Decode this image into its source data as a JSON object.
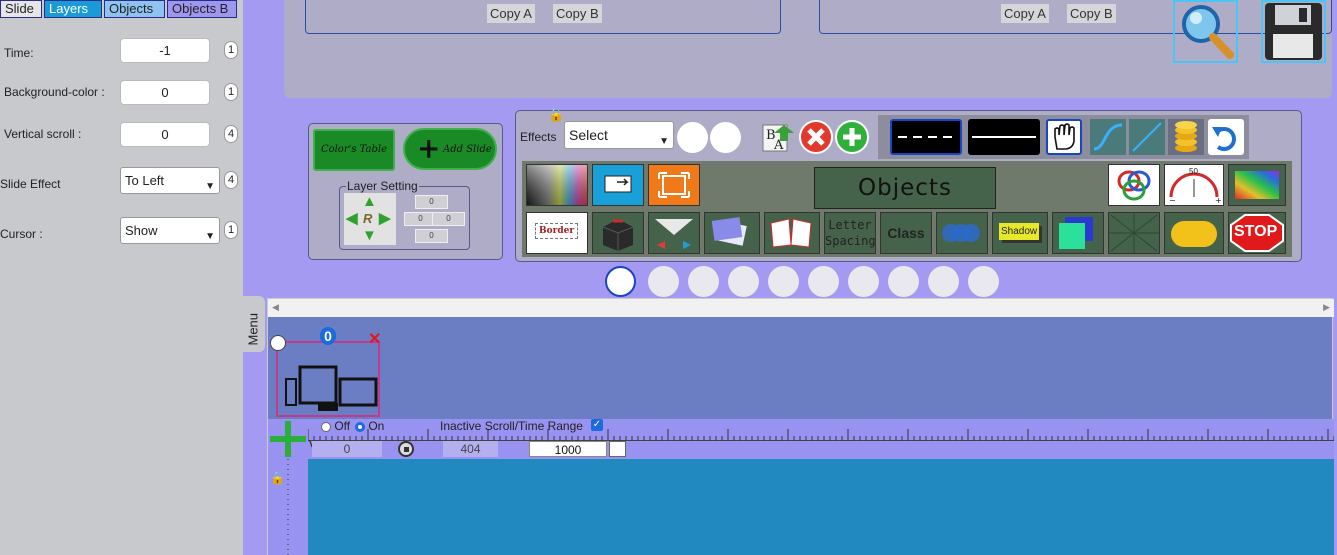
{
  "tabs": [
    "Slide",
    "Layers",
    "Objects",
    "Objects B"
  ],
  "props": {
    "time_label": "Time:",
    "time_value": "-1",
    "time_badge": "1",
    "bg_label": "Background-color :",
    "bg_value": "0",
    "bg_badge": "1",
    "vscroll_label": "Vertical scroll :",
    "vscroll_value": "0",
    "vscroll_badge": "4",
    "effect_label": "Slide Effect",
    "effect_value": "To Left",
    "effect_badge": "4",
    "cursor_label": "Cursor :",
    "cursor_value": "Show",
    "cursor_badge": "1"
  },
  "copy": {
    "a": "Copy A",
    "b": "Copy B"
  },
  "color_panel": {
    "colors_table": "Color's Table",
    "add_slide": "Add Slide",
    "layer_setting": "Layer Setting",
    "fields": [
      "0",
      "0",
      "0",
      "0"
    ]
  },
  "effects": {
    "label": "Effects",
    "select_value": "Select",
    "objects_label": "Objects",
    "border_label": "Border",
    "letter_spacing_line1": "Letter",
    "letter_spacing_line2": "Spacing",
    "class_label": "Class",
    "shadow_label": "Shadow",
    "stop_label": "STOP",
    "gauge_value": "50"
  },
  "menu_label": "Menu",
  "thumb_badge": "0",
  "timeline": {
    "off_label": "Off",
    "on_label": "On",
    "inactive_label": "Inactive Scroll/Time Range",
    "v_label": "V",
    "field1": "0",
    "field2": "404",
    "field3": "1000"
  },
  "colors": {
    "background": "#a59af2",
    "panel": "#aeacc7",
    "left_panel": "#c8c9cd",
    "stage": "#2289c0",
    "accent_blue": "#1a44c8"
  }
}
